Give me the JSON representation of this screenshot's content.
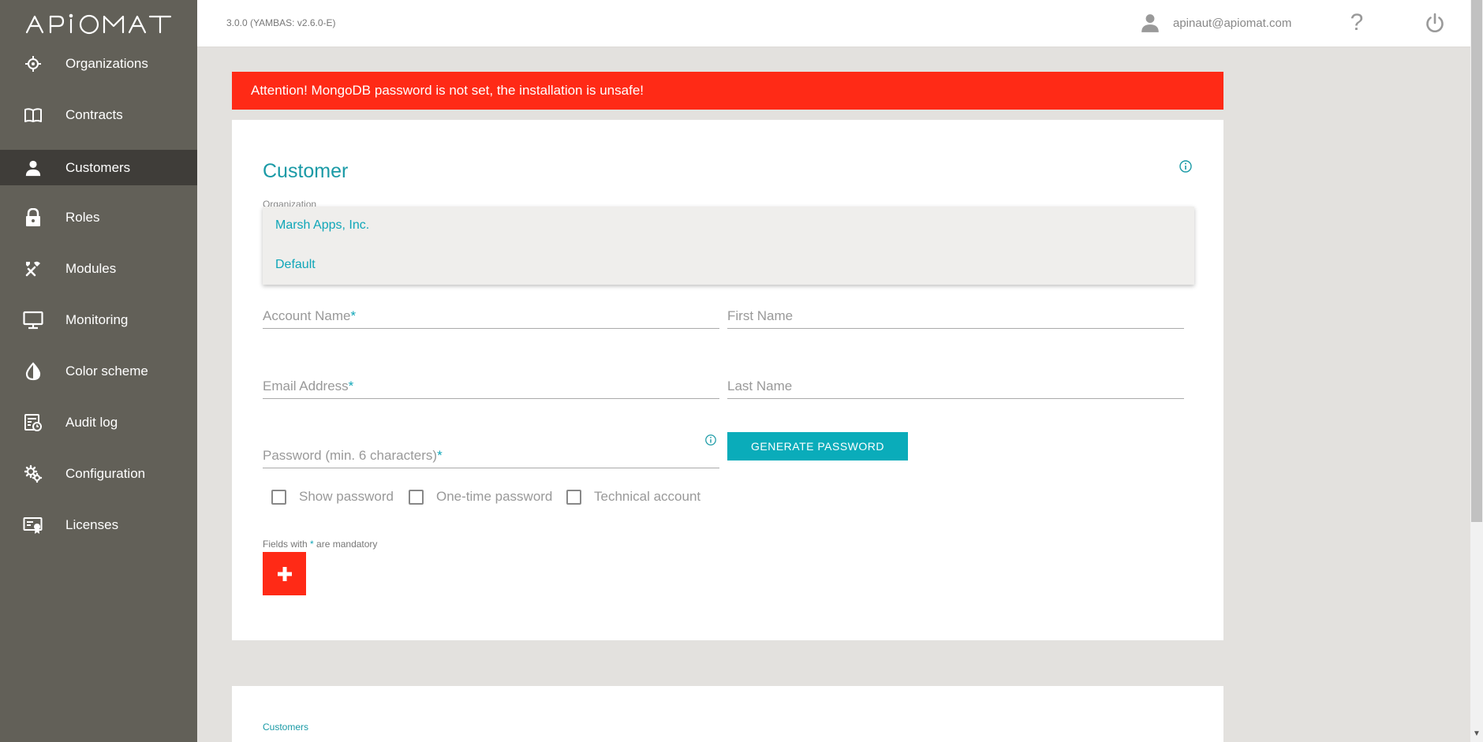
{
  "app": {
    "logo_text": "APIOMAT",
    "version": "3.0.0 (YAMBAS: v2.6.0-E)",
    "user_email": "apinaut@apiomat.com",
    "help_glyph": "?"
  },
  "colors": {
    "sidebar": "#626058",
    "sidebar_active": "#3f3d39",
    "accent": "#0aacba",
    "alert": "#ff2a16"
  },
  "sidebar": {
    "items": [
      {
        "label": "Organizations",
        "icon": "organizations-icon"
      },
      {
        "label": "Contracts",
        "icon": "book-icon"
      },
      {
        "label": "Customers",
        "icon": "person-icon",
        "active": true
      },
      {
        "label": "Roles",
        "icon": "lock-icon"
      },
      {
        "label": "Modules",
        "icon": "tools-icon"
      },
      {
        "label": "Monitoring",
        "icon": "monitor-icon"
      },
      {
        "label": "Color scheme",
        "icon": "drop-icon"
      },
      {
        "label": "Audit log",
        "icon": "audit-log-icon"
      },
      {
        "label": "Configuration",
        "icon": "gears-icon"
      },
      {
        "label": "Licenses",
        "icon": "license-icon"
      }
    ]
  },
  "alert": {
    "text": "Attention! MongoDB password is not set, the installation is unsafe!"
  },
  "form": {
    "title": "Customer",
    "organization_label": "Organization",
    "organization_options": [
      "Marsh Apps, Inc.",
      "Default"
    ],
    "account_name": "Account Name",
    "first_name": "First Name",
    "email_address": "Email Address",
    "last_name": "Last Name",
    "password": "Password (min. 6 characters)",
    "required_mark": "*",
    "generate_password": "GENERATE PASSWORD",
    "checkboxes": [
      "Show password",
      "One-time password",
      "Technical account"
    ],
    "mandatory_prefix": "Fields with",
    "mandatory_suffix": "are mandatory"
  },
  "list": {
    "title": "Customers"
  }
}
